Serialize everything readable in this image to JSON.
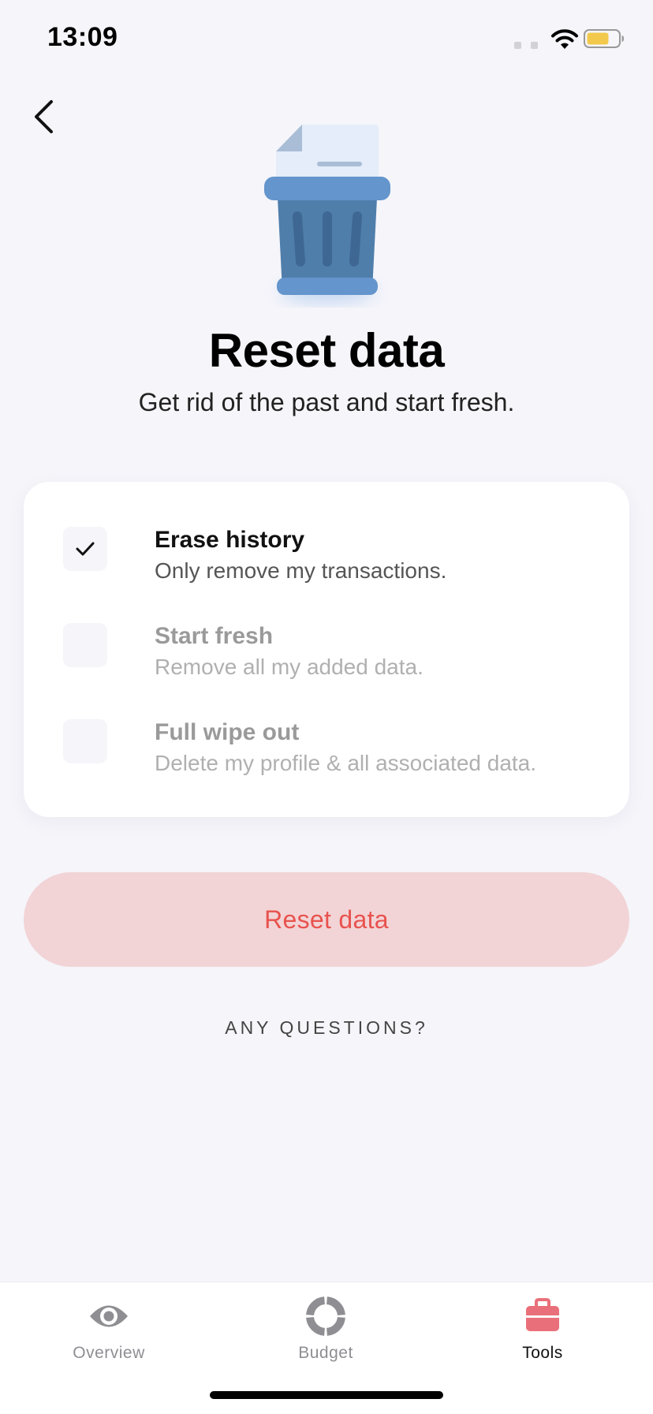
{
  "status_bar": {
    "time": "13:09"
  },
  "header": {
    "back_icon": "chevron-left-icon"
  },
  "hero": {
    "icon": "trash-bin-with-document-icon"
  },
  "title": "Reset data",
  "subtitle": "Get rid of the past and start fresh.",
  "options": [
    {
      "title": "Erase history",
      "description": "Only remove my transactions.",
      "checked": true
    },
    {
      "title": "Start fresh",
      "description": "Remove all my added data.",
      "checked": false
    },
    {
      "title": "Full wipe out",
      "description": "Delete my profile & all associated data.",
      "checked": false
    }
  ],
  "reset_button_label": "Reset data",
  "questions_link": "ANY QUESTIONS?",
  "tab_bar": {
    "tabs": [
      {
        "label": "Overview",
        "icon": "eye-icon",
        "selected": false
      },
      {
        "label": "Budget",
        "icon": "donut-chart-icon",
        "selected": false
      },
      {
        "label": "Tools",
        "icon": "toolbox-icon",
        "selected": true
      }
    ]
  },
  "colors": {
    "background": "#f5f5fa",
    "accent": "#e8524e",
    "button_bg": "#f2d4d6",
    "tools_icon": "#e9707a",
    "trash_blue": "#5f8fc4"
  }
}
